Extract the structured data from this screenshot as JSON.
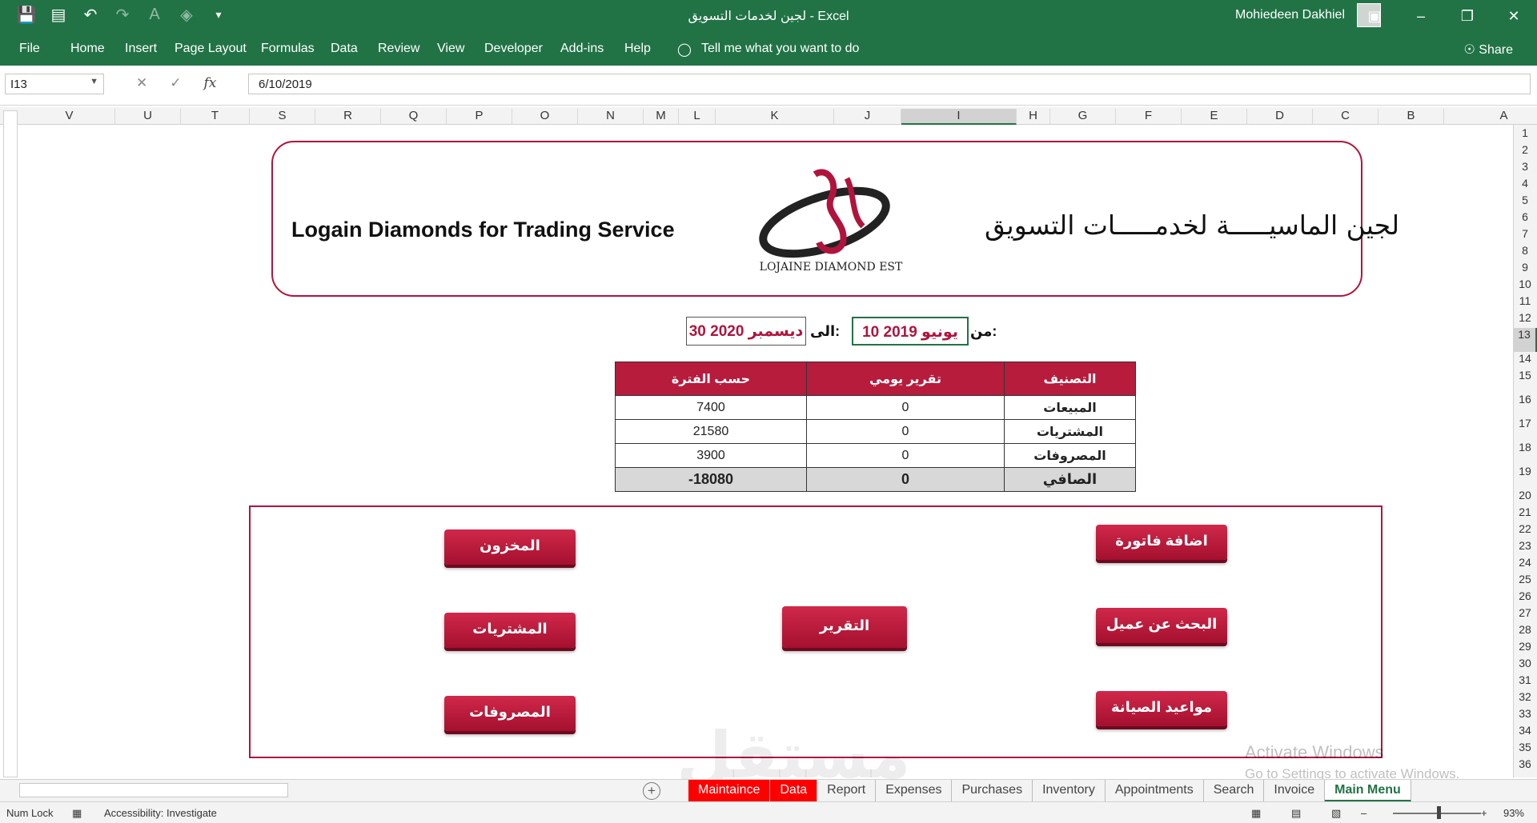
{
  "titlebar": {
    "window_title": "لجين لخدمات التسويق  -  Excel",
    "user": "Mohiedeen Dakhiel",
    "qat_icons": [
      "save-icon",
      "form-icon",
      "undo-icon",
      "redo-icon",
      "font-color-icon",
      "fill-color-icon",
      "customize-icon"
    ],
    "controls": [
      "ribbon-display-icon",
      "minimize-icon",
      "restore-icon",
      "close-icon"
    ]
  },
  "ribbon": {
    "tabs": [
      "File",
      "Home",
      "Insert",
      "Page Layout",
      "Formulas",
      "Data",
      "Review",
      "View",
      "Developer",
      "Add-ins",
      "Help"
    ],
    "tell_me": "Tell me what you want to do",
    "share": "Share"
  },
  "formula_bar": {
    "name_box": "I13",
    "value": "6/10/2019"
  },
  "columns": [
    "V",
    "U",
    "T",
    "S",
    "R",
    "Q",
    "P",
    "O",
    "N",
    "M",
    "L",
    "K",
    "J",
    "I",
    "H",
    "G",
    "F",
    "E",
    "D",
    "C",
    "B",
    "A"
  ],
  "selected_column": "I",
  "rows": [
    "1",
    "2",
    "3",
    "4",
    "5",
    "6",
    "7",
    "8",
    "9",
    "10",
    "11",
    "12",
    "13",
    "14",
    "15",
    "16",
    "17",
    "18",
    "19",
    "20",
    "21",
    "22",
    "23",
    "24",
    "25",
    "26",
    "27",
    "28",
    "29",
    "30",
    "31",
    "32",
    "33",
    "34",
    "35",
    "36"
  ],
  "selected_row": "13",
  "header_card": {
    "english_title": "Logain Diamonds for Trading Service",
    "arabic_title": "لجين الماسيـــــة لخدمـــــات التسويق",
    "logo_text": "LOJAINE DIAMOND EST"
  },
  "date_range": {
    "from_label": "من:",
    "from_value": "10 يونيو 2019",
    "to_label": "الى:",
    "to_value": "30 ديسمبر 2020"
  },
  "summary": {
    "headers": [
      "حسب الفترة",
      "تقرير يومي",
      "التصنيف"
    ],
    "rows": [
      {
        "category": "المبيعات",
        "daily": "0",
        "period": "7400"
      },
      {
        "category": "المشتريات",
        "daily": "0",
        "period": "21580"
      },
      {
        "category": "المصروفات",
        "daily": "0",
        "period": "3900"
      }
    ],
    "total": {
      "category": "الصافي",
      "daily": "0",
      "period": "-18080"
    }
  },
  "buttons": {
    "inventory": "المخزون",
    "purchases": "المشتريات",
    "expenses": "المصروفات",
    "reports": "التقرير",
    "add_invoice": "اضافة فاتورة",
    "search_customer": "البحث عن عميل",
    "maintenance": "مواعيد الصيانة"
  },
  "watermark": {
    "text": "مستقل",
    "activate_title": "Activate Windows",
    "activate_sub": "Go to Settings to activate Windows."
  },
  "sheet_tabs": [
    "Maintaince",
    "Data",
    "Report",
    "Expenses",
    "Purchases",
    "Inventory",
    "Appointments",
    "Search",
    "Invoice",
    "Main Menu"
  ],
  "status": {
    "num_lock": "Num Lock",
    "accessibility": "Accessibility: Investigate",
    "zoom": "93%"
  },
  "colors": {
    "excel_green": "#217346",
    "brand_red": "#b0143c"
  }
}
